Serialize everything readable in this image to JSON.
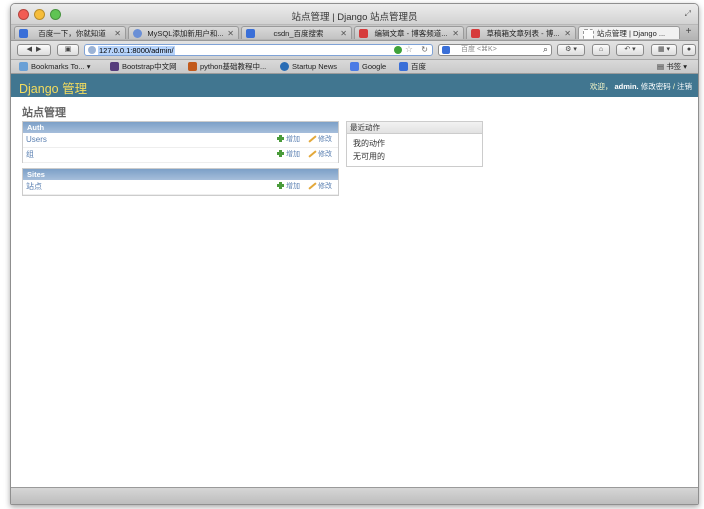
{
  "window": {
    "title": "站点管理 | Django 站点管理员"
  },
  "tabs": [
    {
      "label": "百度一下，你就知道",
      "favicon": "baidu-icon",
      "active": false
    },
    {
      "label": "MySQL添加新用户和...",
      "favicon": "mysql-icon",
      "active": false
    },
    {
      "label": "csdn_百度搜索",
      "favicon": "baidu-icon",
      "active": false
    },
    {
      "label": "编辑文章 - 博客频道...",
      "favicon": "csdn-icon",
      "active": false
    },
    {
      "label": "草稿箱文章列表 - 博...",
      "favicon": "csdn-icon",
      "active": false
    },
    {
      "label": "站点管理 | Django ...",
      "favicon": "blank-page-icon",
      "active": true
    }
  ],
  "nav": {
    "url": "127.0.0.1:8000/admin/",
    "search_placeholder": "百度 <⌘K>"
  },
  "bookmarks": [
    {
      "label": "Bookmarks To...",
      "icon": "folder-icon"
    },
    {
      "label": "Bootstrap中文网",
      "icon": "bootstrap-icon"
    },
    {
      "label": "python基础教程中...",
      "icon": "python-icon"
    },
    {
      "label": "Startup News",
      "icon": "startup-news-icon"
    },
    {
      "label": "Google",
      "icon": "google-icon"
    },
    {
      "label": "百度",
      "icon": "baidu-icon"
    }
  ],
  "bookmarks_right": "书签",
  "django": {
    "branding": "Django 管理",
    "welcome": "欢迎，",
    "username": "admin.",
    "change_password": "修改密码",
    "separator": "/",
    "logout": "注销",
    "page_title": "站点管理",
    "modules": [
      {
        "caption": "Auth",
        "models": [
          {
            "name": "Users",
            "add": "增加",
            "change": "修改"
          },
          {
            "name": "组",
            "add": "增加",
            "change": "修改"
          }
        ]
      },
      {
        "caption": "Sites",
        "models": [
          {
            "name": "站点",
            "add": "增加",
            "change": "修改"
          }
        ]
      }
    ],
    "recent_actions": {
      "title": "最近动作",
      "heading": "我的动作",
      "empty": "无可用的"
    }
  },
  "colors": {
    "header_bg": "#417690",
    "branding": "#f5dd5d",
    "link": "#5b80b2",
    "caption_bg": "#7ca0c7"
  }
}
